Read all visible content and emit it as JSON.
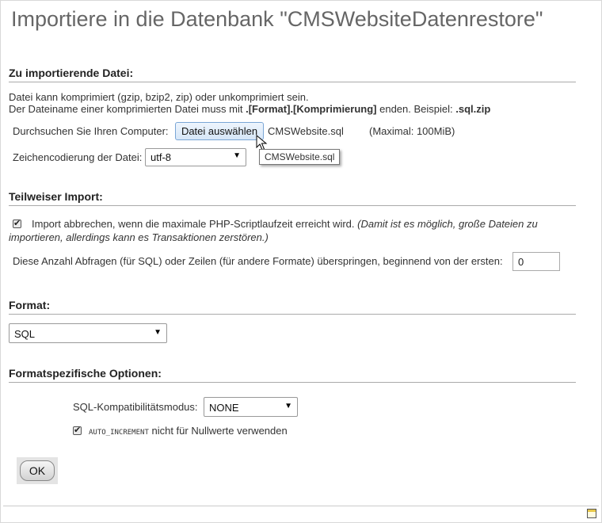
{
  "page": {
    "title": "Importiere in die Datenbank \"CMSWebsiteDatenrestore\""
  },
  "file_section": {
    "heading": "Zu importierende Datei:",
    "info_line1": "Datei kann komprimiert (gzip, bzip2, zip) oder unkomprimiert sein.",
    "info_line2_prefix": "Der Dateiname einer komprimierten Datei muss mit ",
    "info_line2_bold": ".[Format].[Komprimierung]",
    "info_line2_mid": " enden. Beispiel: ",
    "info_line2_example": ".sql.zip",
    "browse_label": "Durchsuchen Sie Ihren Computer:",
    "choose_button": "Datei auswählen",
    "selected_file": "CMSWebsite.sql",
    "max_size": "(Maximal: 100MiB)",
    "tooltip": "CMSWebsite.sql",
    "charset_label": "Zeichencodierung der Datei:",
    "charset_value": "utf-8"
  },
  "partial_section": {
    "heading": "Teilweiser Import:",
    "abort_checked": true,
    "abort_label": "Import abbrechen, wenn die maximale PHP-Scriptlaufzeit erreicht wird.",
    "abort_note_line1": "(Damit ist es möglich, große Dateien zu",
    "abort_note_line2": "importieren, allerdings kann es Transaktionen zerstören.)",
    "skip_label": "Diese Anzahl Abfragen (für SQL) oder Zeilen (für andere Formate) überspringen, beginnend von der ersten:",
    "skip_value": "0"
  },
  "format_section": {
    "heading": "Format:",
    "format_value": "SQL"
  },
  "options_section": {
    "heading": "Formatspezifische Optionen:",
    "compat_label": "SQL-Kompatibilitätsmodus:",
    "compat_value": "NONE",
    "auto_inc_checked": true,
    "auto_inc_code": "AUTO_INCREMENT",
    "auto_inc_label": " nicht für Nullwerte verwenden"
  },
  "actions": {
    "ok_label": "OK"
  },
  "icons": {
    "dropdown": "triangle-down-icon",
    "cursor": "mouse-pointer-icon",
    "footer": "console-icon",
    "check": "checkmark-icon"
  }
}
